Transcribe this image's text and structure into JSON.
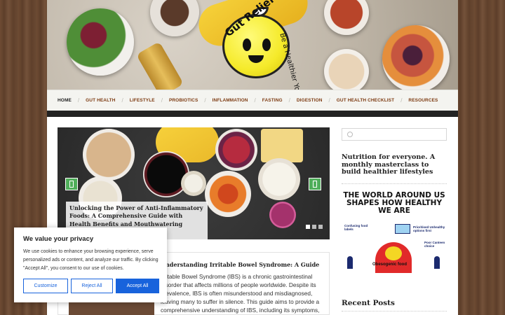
{
  "logo": {
    "title": "Gut Relief",
    "tagline": "Be a Healthier You"
  },
  "nav": {
    "items": [
      "HOME",
      "GUT HEALTH",
      "LIFESTYLE",
      "PROBIOTICS",
      "INFLAMMATION",
      "FASTING",
      "DIGESTION",
      "GUT HEALTH CHECKLIST",
      "RESOURCES"
    ]
  },
  "slider": {
    "caption": "Unlocking the Power of Anti-Inflammatory Foods: A Comprehensive Guide with Health Benefits and Mouthwatering Recipes",
    "dots": 3,
    "active_dot": 0
  },
  "post": {
    "title": "Understanding Irritable Bowel Syndrome: A Guide",
    "excerpt": "Irritable Bowel Syndrome (IBS) is a chronic gastrointestinal disorder that affects millions of people worldwide. Despite its prevalence, IBS is often misunderstood and misdiagnosed, leaving many to suffer in silence. This guide aims to provide a comprehensive understanding of IBS, including its symptoms, causes, management strategies"
  },
  "sidebar": {
    "promo": "Nutrition for everyone. A monthly masterclass to build healthier lifestyles",
    "infographic_title": "THE WORLD AROUND US SHAPES HOW HEALTHY WE ARE",
    "infographic_labels": {
      "confusing": "Confusing food labels",
      "prioritized": "Prioritised Unhealthy options first",
      "poor": "Poor Canteen choice",
      "obesogenic": "Obesogenic food"
    },
    "recent_heading": "Recent Posts"
  },
  "cookie": {
    "title": "We value your privacy",
    "text": "We use cookies to enhance your browsing experience, serve personalized ads or content, and analyze our traffic. By clicking \"Accept All\", you consent to our use of cookies.",
    "customize": "Customize",
    "reject": "Reject All",
    "accept": "Accept All"
  },
  "colors": {
    "nav_text": "#7d3b12",
    "accent_green": "#4fae5a",
    "cookie_blue": "#1863dc"
  }
}
